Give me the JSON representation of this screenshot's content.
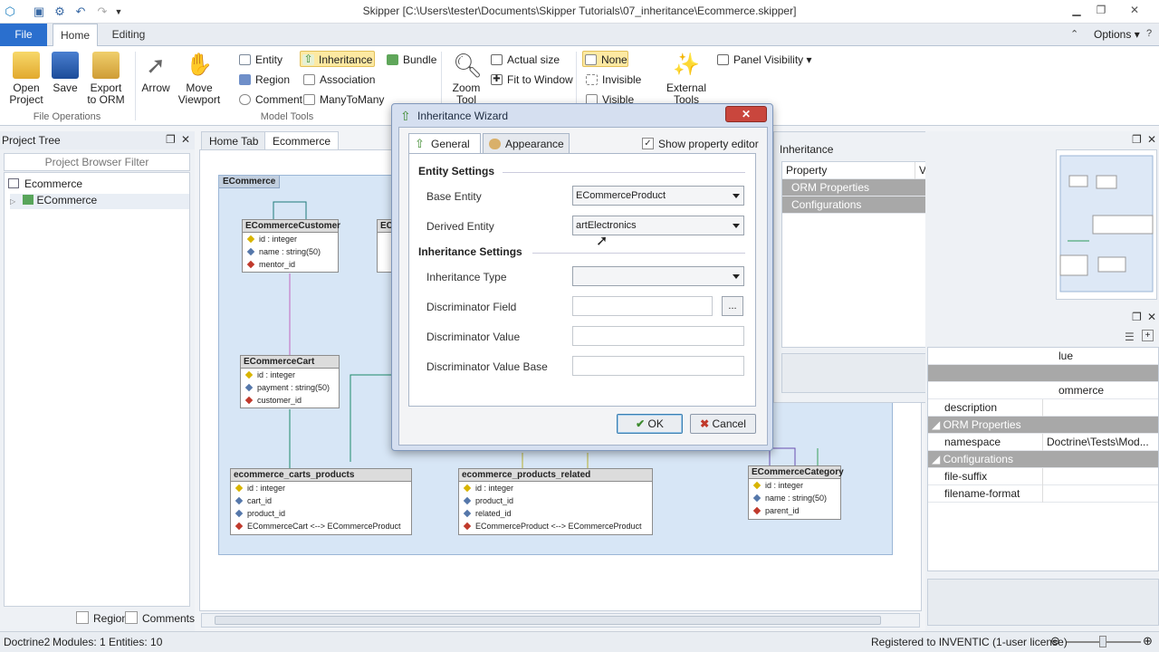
{
  "window": {
    "title": "Skipper [C:\\Users\\tester\\Documents\\Skipper Tutorials\\07_inheritance\\Ecommerce.skipper]"
  },
  "ribbon_tabs": {
    "file": "File",
    "home": "Home",
    "editing": "Editing"
  },
  "options_label": "Options",
  "file_ops": {
    "open": "Open Project",
    "open_l1": "Open",
    "open_l2": "Project",
    "save": "Save",
    "export_l1": "Export",
    "export_l2": "to ORM",
    "group": "File Operations"
  },
  "tools": {
    "arrow": "Arrow",
    "move_l1": "Move",
    "move_l2": "Viewport",
    "entity": "Entity",
    "region": "Region",
    "comment": "Comment",
    "inheritance": "Inheritance",
    "association": "Association",
    "manytomany": "ManyToMany",
    "bundle": "Bundle",
    "group": "Model Tools"
  },
  "zoom": {
    "zoom_l1": "Zoom",
    "zoom_l2": "Tool",
    "actual": "Actual size",
    "fit": "Fit to Window"
  },
  "visibility": {
    "none": "None",
    "invisible": "Invisible",
    "visible": "Visible",
    "external_l1": "External",
    "external_l2": "Tools",
    "panel_visibility": "Panel Visibility"
  },
  "project_tree": {
    "title": "Project Tree",
    "filter_placeholder": "Project Browser Filter",
    "root": "Ecommerce",
    "child": "ECommerce",
    "regions_label": "Regions",
    "comments_label": "Comments"
  },
  "doc_tabs": {
    "home": "Home Tab",
    "ecommerce": "Ecommerce"
  },
  "diagram": {
    "region_name": "ECommerce",
    "customer": {
      "name": "ECommerceCustomer",
      "fields": [
        "id : integer",
        "name : string(50)",
        "mentor_id"
      ]
    },
    "ec_partial": "EC",
    "cart": {
      "name": "ECommerceCart",
      "fields": [
        "id : integer",
        "payment : string(50)",
        "customer_id"
      ]
    },
    "carts_products": {
      "name": "ecommerce_carts_products",
      "fields": [
        "id : integer",
        "cart_id",
        "product_id",
        "ECommerceCart <--> ECommerceProduct"
      ]
    },
    "products_related": {
      "name": "ecommerce_products_related",
      "fields": [
        "id : integer",
        "product_id",
        "related_id",
        "ECommerceProduct <--> ECommerceProduct"
      ]
    },
    "category": {
      "name": "ECommerceCategory",
      "fields": [
        "id : integer",
        "name : string(50)",
        "parent_id"
      ]
    }
  },
  "properties_panel": {
    "title": "Inheritance",
    "col_property": "Property",
    "col_value": "Value",
    "orm": "ORM Properties",
    "config": "Configurations"
  },
  "right_props": {
    "col_value_partial": "lue",
    "value_partial": "ommerce",
    "rows": [
      {
        "name": "description",
        "value": ""
      }
    ],
    "orm_section": "ORM Properties",
    "namespace": {
      "name": "namespace",
      "value": "Doctrine\\Tests\\Mod..."
    },
    "config_section": "Configurations",
    "file_suffix": "file-suffix",
    "filename_format": "filename-format"
  },
  "wizard": {
    "title": "Inheritance Wizard",
    "tab_general": "General",
    "tab_appearance": "Appearance",
    "show_editor": "Show property editor",
    "entity_settings": "Entity Settings",
    "base_entity_label": "Base Entity",
    "base_entity_value": "ECommerceProduct",
    "derived_entity_label": "Derived Entity",
    "derived_entity_value": "artElectronics",
    "inheritance_settings": "Inheritance Settings",
    "inheritance_type_label": "Inheritance Type",
    "inheritance_type_value": "",
    "disc_field_label": "Discriminator Field",
    "disc_field_btn": "...",
    "disc_value_label": "Discriminator Value",
    "disc_value_base_label": "Discriminator Value Base",
    "ok": "OK",
    "cancel": "Cancel"
  },
  "statusbar": {
    "orm": "Doctrine2",
    "modules": "Modules: 1",
    "entities": "Entities: 10",
    "license": "Registered to INVENTIC (1-user license)"
  }
}
